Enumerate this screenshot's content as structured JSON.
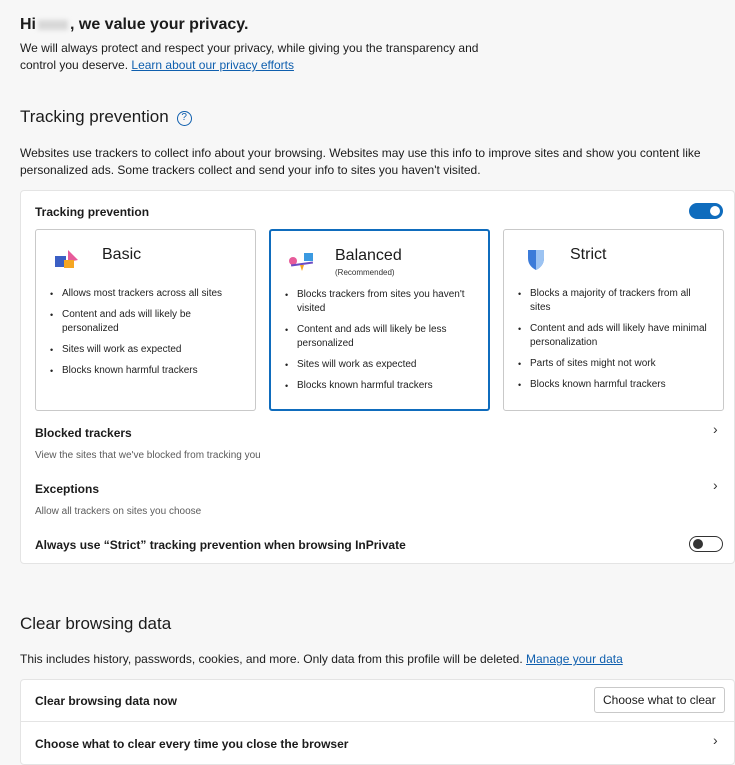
{
  "greeting": {
    "title_prefix": "Hi",
    "title_suffix": ", we value your privacy.",
    "desc": "We will always protect and respect your privacy, while giving you the transparency and control you deserve.",
    "link": "Learn about our privacy efforts"
  },
  "tracking": {
    "title": "Tracking prevention",
    "desc": "Websites use trackers to collect info about your browsing. Websites may use this info to improve sites and show you content like personalized ads. Some trackers collect and send your info to sites you haven't visited.",
    "toggle_label": "Tracking prevention",
    "toggle_on": true,
    "options": [
      {
        "title": "Basic",
        "subtitle": "",
        "bullets": [
          "Allows most trackers across all sites",
          "Content and ads will likely be personalized",
          "Sites will work as expected",
          "Blocks known harmful trackers"
        ]
      },
      {
        "title": "Balanced",
        "subtitle": "(Recommended)",
        "bullets": [
          "Blocks trackers from sites you haven't visited",
          "Content and ads will likely be less personalized",
          "Sites will work as expected",
          "Blocks known harmful trackers"
        ]
      },
      {
        "title": "Strict",
        "subtitle": "",
        "bullets": [
          "Blocks a majority of trackers from all sites",
          "Content and ads will likely have minimal personalization",
          "Parts of sites might not work",
          "Blocks known harmful trackers"
        ]
      }
    ],
    "selected": "Balanced",
    "blocked_label": "Blocked trackers",
    "blocked_sub": "View the sites that we've blocked from tracking you",
    "exceptions_label": "Exceptions",
    "exceptions_sub": "Allow all trackers on sites you choose",
    "inprivate_label": "Always use “Strict” tracking prevention when browsing InPrivate",
    "inprivate_on": false
  },
  "clear": {
    "title": "Clear browsing data",
    "desc": "This includes history, passwords, cookies, and more. Only data from this profile will be deleted.",
    "link": "Manage your data",
    "now_label": "Clear browsing data now",
    "now_button": "Choose what to clear",
    "close_label": "Choose what to clear every time you close the browser"
  },
  "colors": {
    "accent": "#0f6cbd",
    "link": "#0f5fae",
    "page_bg": "#f7f7f7"
  }
}
